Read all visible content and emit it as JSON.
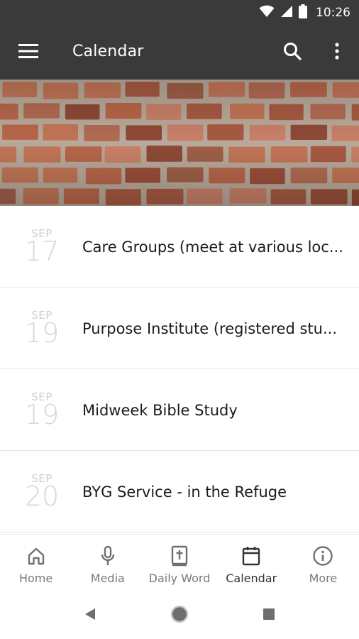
{
  "status_bar": {
    "time": "10:26",
    "icons": [
      "wifi-icon",
      "signal-icon",
      "battery-icon"
    ]
  },
  "app_bar": {
    "title": "Calendar",
    "background": "#3a3a3a",
    "icons": [
      "menu-icon",
      "search-icon",
      "more-vert-icon"
    ]
  },
  "banner": {
    "description_icon": "brick-wall-image"
  },
  "events": [
    {
      "month": "SEP",
      "day": "17",
      "title": "Care Groups (meet at various loc..."
    },
    {
      "month": "SEP",
      "day": "19",
      "title": "Purpose Institute (registered stu..."
    },
    {
      "month": "SEP",
      "day": "19",
      "title": "Midweek Bible Study"
    },
    {
      "month": "SEP",
      "day": "20",
      "title": "BYG Service - in the Refuge"
    }
  ],
  "bottom_nav": {
    "items": [
      {
        "label": "Home",
        "icon": "home-icon"
      },
      {
        "label": "Media",
        "icon": "microphone-icon"
      },
      {
        "label": "Daily Word",
        "icon": "bible-icon"
      },
      {
        "label": "Calendar",
        "icon": "calendar-icon",
        "active": true
      },
      {
        "label": "More",
        "icon": "info-icon"
      }
    ]
  },
  "system_nav": {
    "icons": [
      "back-icon",
      "home-circle-icon",
      "recents-icon"
    ]
  }
}
